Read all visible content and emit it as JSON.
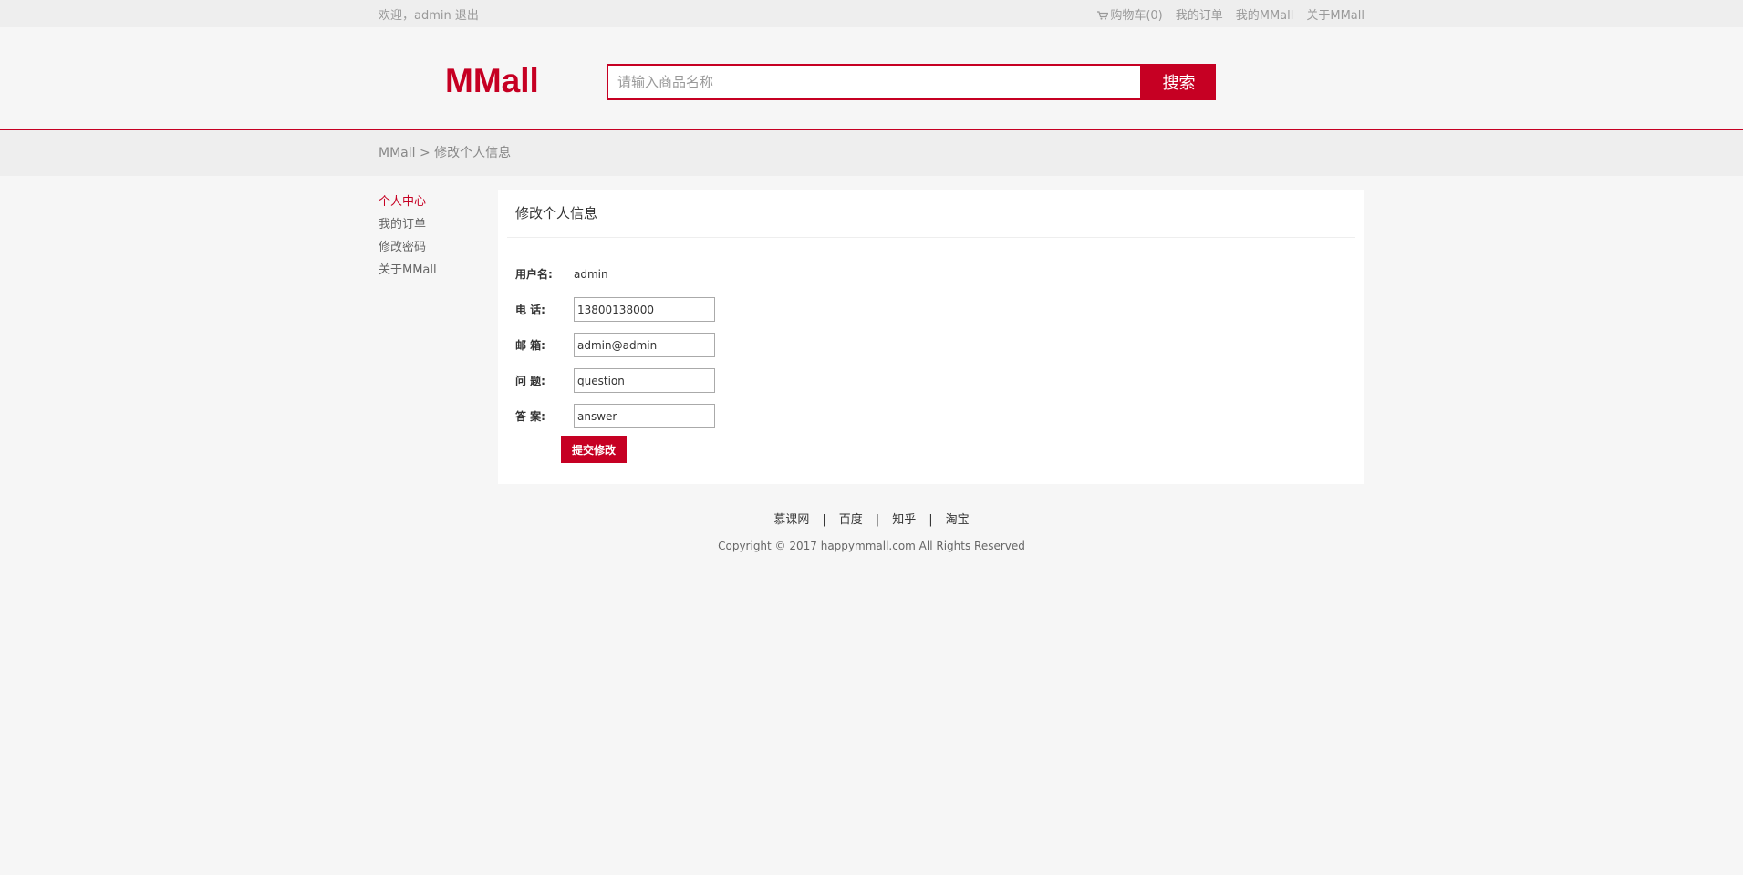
{
  "topbar": {
    "welcome": "欢迎，admin",
    "logout": "退出",
    "cart": "购物车(0)",
    "my_orders": "我的订单",
    "my_mmall": "我的MMall",
    "about": "关于MMall"
  },
  "header": {
    "logo": "MMall",
    "search_placeholder": "请输入商品名称",
    "search_button": "搜索"
  },
  "breadcrumb": {
    "home": "MMall",
    "separator": " > ",
    "current": "修改个人信息"
  },
  "sidebar": {
    "items": [
      {
        "label": "个人中心",
        "active": true
      },
      {
        "label": "我的订单",
        "active": false
      },
      {
        "label": "修改密码",
        "active": false
      },
      {
        "label": "关于MMall",
        "active": false
      }
    ]
  },
  "panel": {
    "title": "修改个人信息",
    "username_label": "用户名:",
    "username_value": "admin",
    "phone_label": "电 话:",
    "phone_value": "13800138000",
    "email_label": "邮 箱:",
    "email_value": "admin@admin",
    "question_label": "问 题:",
    "question_value": "question",
    "answer_label": "答 案:",
    "answer_value": "answer",
    "submit_label": "提交修改"
  },
  "footer": {
    "links": [
      "慕课网",
      "百度",
      "知乎",
      "淘宝"
    ],
    "separator": "|",
    "copyright": "Copyright © 2017 happymmall.com All Rights Reserved"
  },
  "colors": {
    "brand": "#c60023",
    "background": "#f6f6f6",
    "bar": "#eeeeee"
  },
  "icons": {
    "cart": "cart-icon"
  }
}
